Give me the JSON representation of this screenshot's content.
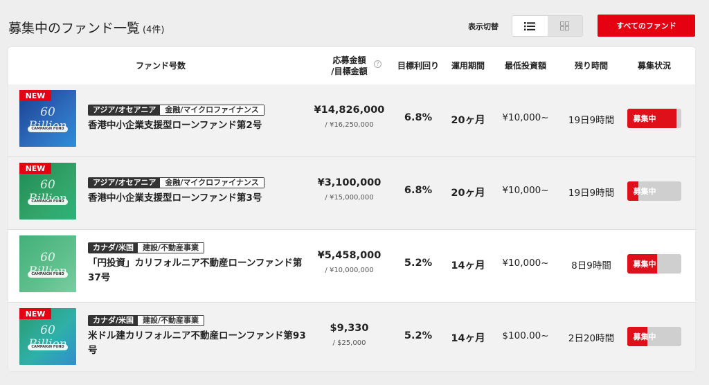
{
  "header": {
    "title": "募集中のファンド一覧",
    "count": "(4件)",
    "toggle_label": "表示切替",
    "all_funds_button": "すべてのファンド"
  },
  "columns": {
    "fund": "ファンド号数",
    "amount_line1": "応募金額",
    "amount_line2": "/目標金額",
    "yield": "目標利回り",
    "period": "運用期間",
    "min_invest": "最低投資額",
    "remaining": "残り時間",
    "status": "募集状況"
  },
  "thumb": {
    "title": "60 Billion",
    "band": "CAMPAIGN FUND"
  },
  "funds": [
    {
      "new": "NEW",
      "region": "アジア/オセアニア",
      "category": "金融/マイクロファイナンス",
      "name": "香港中小企業支援型ローンファンド第2号",
      "amount": "¥14,826,000",
      "target": "/ ¥16,250,000",
      "yield": "6.8%",
      "period": "20ヶ月",
      "min_invest": "¥10,000~",
      "remaining": "19日9時間",
      "status": "募集中",
      "progress": 0.91,
      "thumb_color": "#2f6fc0"
    },
    {
      "new": "NEW",
      "region": "アジア/オセアニア",
      "category": "金融/マイクロファイナンス",
      "name": "香港中小企業支援型ローンファンド第3号",
      "amount": "¥3,100,000",
      "target": "/ ¥15,000,000",
      "yield": "6.8%",
      "period": "20ヶ月",
      "min_invest": "¥10,000~",
      "remaining": "19日9時間",
      "status": "募集中",
      "progress": 0.21,
      "thumb_color": "#34a56a"
    },
    {
      "new": "",
      "region": "カナダ/米国",
      "category": "建設/不動産事業",
      "name": "「円投資」カリフォルニア不動産ローンファンド第37号",
      "amount": "¥5,458,000",
      "target": "/ ¥10,000,000",
      "yield": "5.2%",
      "period": "14ヶ月",
      "min_invest": "¥10,000~",
      "remaining": "8日9時間",
      "status": "募集中",
      "progress": 0.55,
      "thumb_color": "#5fc08e"
    },
    {
      "new": "NEW",
      "region": "カナダ/米国",
      "category": "建設/不動産事業",
      "name": "米ドル建カリフォルニア不動産ローンファンド第93号",
      "amount": "$9,330",
      "target": "/ $25,000",
      "yield": "5.2%",
      "period": "14ヶ月",
      "min_invest": "$100.00~",
      "remaining": "2日20時間",
      "status": "募集中",
      "progress": 0.37,
      "thumb_color": "#2fb0a8"
    }
  ],
  "colors": {
    "accent": "#e50012",
    "status_bar": "#e0101a"
  }
}
